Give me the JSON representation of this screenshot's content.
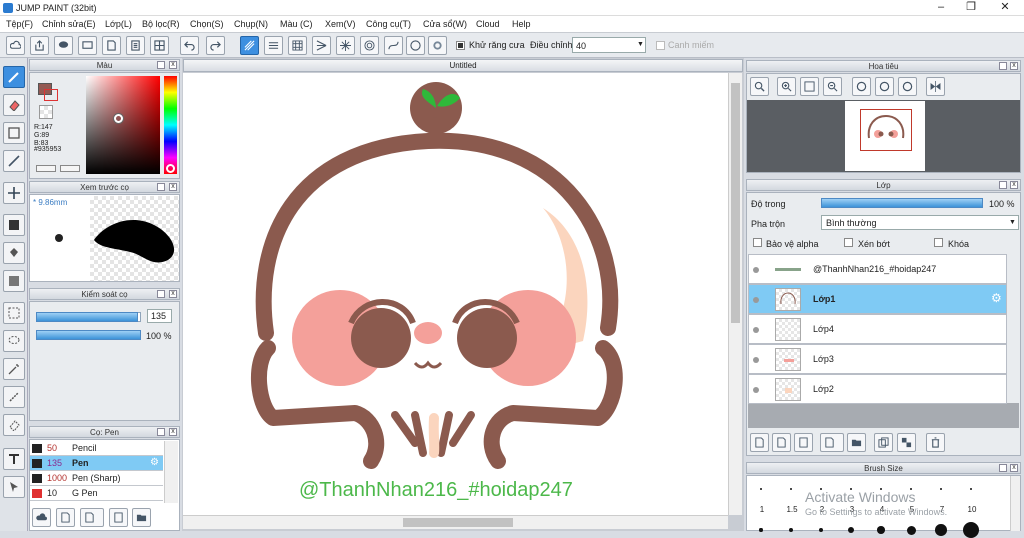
{
  "window": {
    "title": "JUMP PAINT (32bit)"
  },
  "menu": [
    "Tệp(F)",
    "Chỉnh sửa(E)",
    "Lớp(L)",
    "Bộ lọc(R)",
    "Chọn(S)",
    "Chụp(N)",
    "Màu (C)",
    "Xem(V)",
    "Công cụ(T)",
    "Cửa sổ(W)",
    "Cloud",
    "Help"
  ],
  "toolbar": {
    "antialias_label": "Khử răng cưa",
    "adjust_label": "Điều chỉnh",
    "adjust_value": "40",
    "snap_label": "Canh miếm"
  },
  "color_panel": {
    "title": "Màu",
    "r": "R:147",
    "g": "G:89",
    "b": "B:83",
    "hex": "#935953",
    "main_color": "#935953"
  },
  "preview_panel": {
    "title": "Xem trước cọ",
    "size": "* 9.86mm"
  },
  "control_panel": {
    "title": "Kiểm soát cọ",
    "size_value": "135",
    "opacity_value": "100 %",
    "size_fraction": 0.97,
    "opacity_fraction": 1.0
  },
  "brush_panel": {
    "title": "Cọ: Pen",
    "items": [
      {
        "size": "50",
        "name": "Pencil"
      },
      {
        "size": "135",
        "name": "Pen",
        "selected": true
      },
      {
        "size": "1000",
        "name": "Pen (Sharp)"
      },
      {
        "size": "10",
        "name": "G Pen"
      }
    ]
  },
  "canvas": {
    "doc_title": "Untitled",
    "watermark_text": "@ThanhNhan216_#hoidap247"
  },
  "navigator": {
    "title": "Hoa tiêu"
  },
  "layer_panel": {
    "title": "Lớp",
    "opacity_label": "Độ trong",
    "opacity_value": "100 %",
    "opacity_fraction": 1.0,
    "blend_label": "Pha trộn",
    "blend_value": "Bình thường",
    "protect_alpha": "Bảo vệ alpha",
    "clip": "Xén bớt",
    "lock": "Khóa",
    "layers": [
      {
        "name": "@ThanhNhan216_#hoidap247"
      },
      {
        "name": "Lớp1",
        "selected": true
      },
      {
        "name": "Lớp4"
      },
      {
        "name": "Lớp3"
      },
      {
        "name": "Lớp2"
      }
    ]
  },
  "brush_size_panel": {
    "title": "Brush Size",
    "sizes": [
      "1",
      "1.5",
      "2",
      "3",
      "4",
      "5",
      "7",
      "10"
    ],
    "watermark_line1": "Activate Windows",
    "watermark_line2": "Go to Settings to activate Windows."
  },
  "colors": {
    "accent": "#3d8fe0",
    "selection": "#7fcaf4",
    "brown": "#8b5a4e",
    "pink": "#f4a09a",
    "watermark_green": "#4cb84a"
  }
}
